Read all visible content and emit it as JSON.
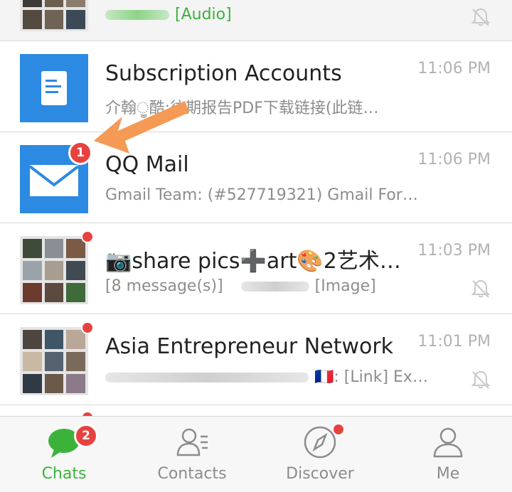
{
  "colors": {
    "accent": "#3bb33b",
    "badge": "#e64340",
    "blue_avatar": "#2c8ae2",
    "arrow": "#f59a55"
  },
  "chats": [
    {
      "name": "",
      "preview": "[Audio]",
      "time": "",
      "muted": true
    },
    {
      "name": "Subscription Accounts",
      "preview": "介翰ੂ酷:往期报告PDF下载链接(此链…",
      "time": "11:06 PM",
      "icon": "document-icon"
    },
    {
      "name": "QQ Mail",
      "preview": "Gmail Team: (#527719321) Gmail For…",
      "time": "11:06 PM",
      "badge": "1",
      "icon": "envelope-icon"
    },
    {
      "name": "📷share pics➕art🎨2艺术…",
      "preview_prefix": "[8 message(s)]",
      "preview": "[Image]",
      "time": "11:03 PM",
      "muted": true,
      "dot": true
    },
    {
      "name": "Asia Entrepreneur Network",
      "preview_flag": "🇫🇷",
      "preview": ": [Link] Ex…",
      "time": "11:01 PM",
      "muted": true,
      "dot": true
    }
  ],
  "tabs": [
    {
      "label": "Chats",
      "icon": "chat-bubble-icon",
      "badge": "2",
      "active": true
    },
    {
      "label": "Contacts",
      "icon": "contacts-icon"
    },
    {
      "label": "Discover",
      "icon": "compass-icon",
      "dot": true
    },
    {
      "label": "Me",
      "icon": "person-icon"
    }
  ]
}
